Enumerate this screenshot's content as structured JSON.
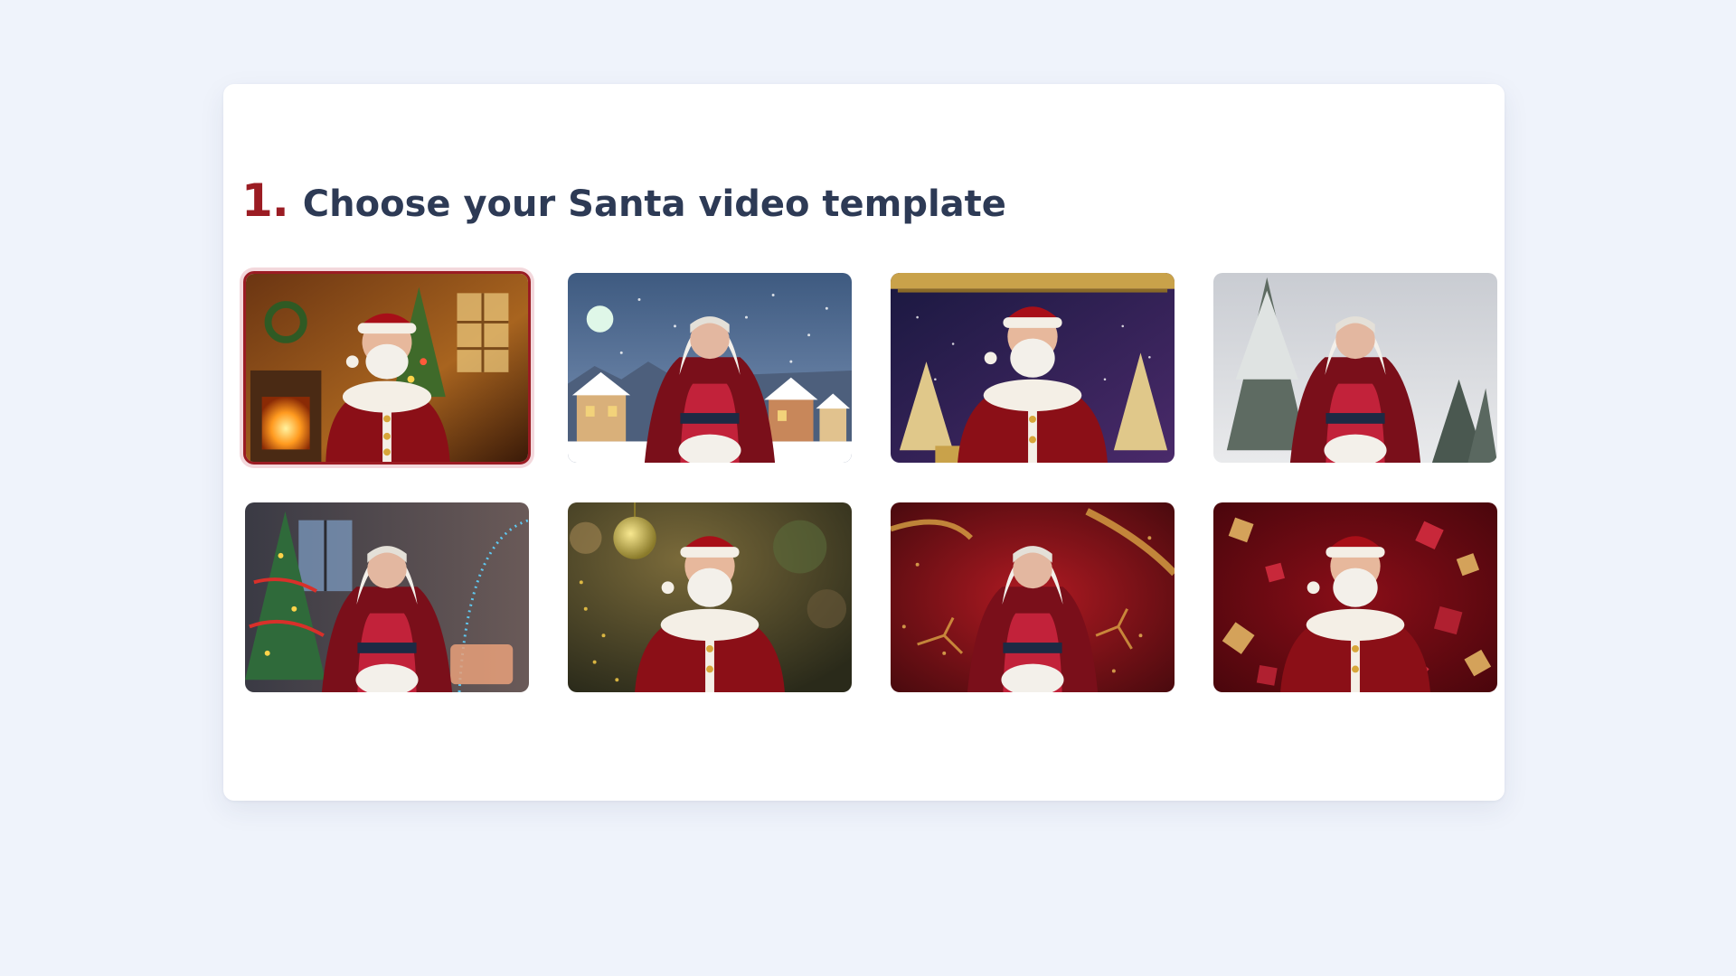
{
  "section": {
    "step_number": "1.",
    "title": "Choose your Santa video template"
  },
  "templates": [
    {
      "character": "santa",
      "scene": "living room fireplace",
      "selected": true
    },
    {
      "character": "mrs-claus",
      "scene": "snowy village night",
      "selected": false
    },
    {
      "character": "santa",
      "scene": "gold frame starry night",
      "selected": false
    },
    {
      "character": "mrs-claus",
      "scene": "snowy pine forest",
      "selected": false
    },
    {
      "character": "mrs-claus",
      "scene": "christmas tree window",
      "selected": false
    },
    {
      "character": "santa",
      "scene": "gold bauble bokeh",
      "selected": false
    },
    {
      "character": "mrs-claus",
      "scene": "red gold reindeer",
      "selected": false
    },
    {
      "character": "santa",
      "scene": "flying gift boxes",
      "selected": false
    }
  ],
  "colors": {
    "page_background": "#eff3fb",
    "accent": "#9b1c23",
    "heading": "#2d3a55"
  }
}
